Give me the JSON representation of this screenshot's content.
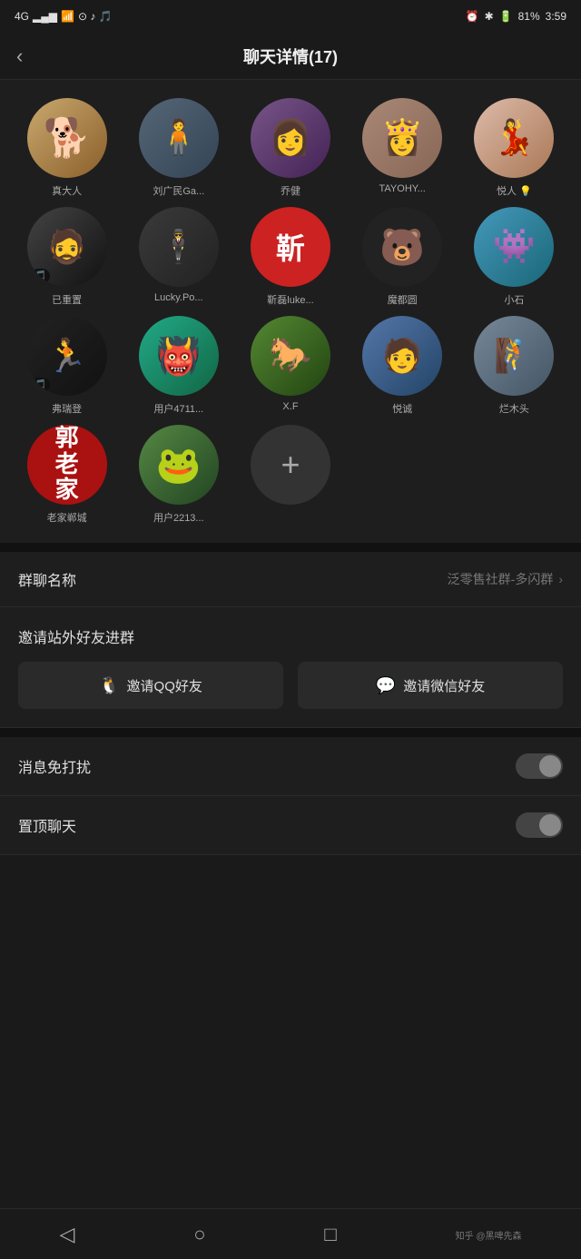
{
  "statusBar": {
    "signal": "4G",
    "wifi": "WiFi",
    "time": "3:59",
    "battery": "81%"
  },
  "header": {
    "backLabel": "‹",
    "title": "聊天详情(17)"
  },
  "members": [
    {
      "name": "真大人",
      "avatarType": "dog"
    },
    {
      "name": "刘广民Ga...",
      "avatarType": "man1"
    },
    {
      "name": "乔健",
      "avatarType": "girl1"
    },
    {
      "name": "TAYOHY...",
      "avatarType": "ancient"
    },
    {
      "name": "悦人 💡",
      "avatarType": "vintage"
    },
    {
      "name": "已重置",
      "avatarType": "hatman"
    },
    {
      "name": "Lucky.Po...",
      "avatarType": "lucky"
    },
    {
      "name": "靳磊luke...",
      "avatarType": "cnred"
    },
    {
      "name": "魔都圆",
      "avatarType": "bear"
    },
    {
      "name": "小石",
      "avatarType": "cyan"
    },
    {
      "name": "弗瑞登",
      "avatarType": "runner"
    },
    {
      "name": "用户4711...",
      "avatarType": "monster"
    },
    {
      "name": "X.F",
      "avatarType": "horse"
    },
    {
      "name": "悦诚",
      "avatarType": "bluelake"
    },
    {
      "name": "烂木头",
      "avatarType": "outdoor"
    },
    {
      "name": "老家郸城",
      "avatarType": "redguo"
    },
    {
      "name": "用户2213...",
      "avatarType": "frog"
    }
  ],
  "addButton": "+",
  "settings": {
    "groupName": {
      "label": "群聊名称",
      "value": "泛零售社群-多闪群"
    },
    "inviteSection": {
      "label": "邀请站外好友进群",
      "qqBtn": "邀请QQ好友",
      "wechatBtn": "邀请微信好友"
    },
    "doNotDisturb": {
      "label": "消息免打扰",
      "enabled": false
    },
    "pinChat": {
      "label": "置顶聊天",
      "enabled": false
    }
  },
  "bottomNav": {
    "back": "◁",
    "home": "○",
    "recent": "□",
    "zhihu": "知乎 @黑啤先森"
  }
}
